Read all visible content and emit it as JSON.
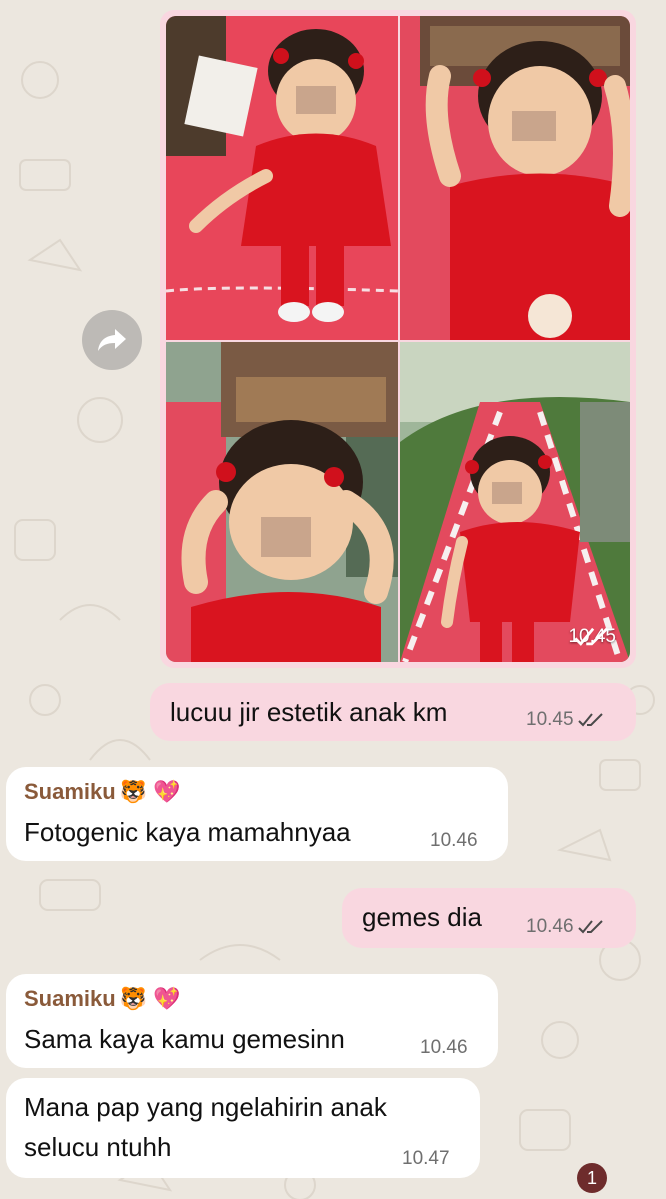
{
  "colors": {
    "chat_background": "#ece7df",
    "outgoing_bubble": "#f9d7e0",
    "incoming_bubble": "#ffffff",
    "sender_name": "#8a5a3a",
    "unread_badge": "#6e2c2c"
  },
  "photo_message": {
    "photo_count": 4,
    "time": "10.45",
    "status_icon": "double-check-icon"
  },
  "messages": [
    {
      "direction": "outgoing",
      "text": "lucuu jir estetik anak km",
      "time": "10.45",
      "status_icon": "double-check-icon"
    },
    {
      "direction": "incoming",
      "sender": "Suamiku",
      "sender_emoji": "🐯 💖",
      "text": "Fotogenic kaya mamahnyaa",
      "time": "10.46"
    },
    {
      "direction": "outgoing",
      "text": "gemes dia",
      "time": "10.46",
      "status_icon": "double-check-icon"
    },
    {
      "direction": "incoming",
      "sender": "Suamiku",
      "sender_emoji": "🐯 💖",
      "text": "Sama kaya kamu gemesinn",
      "time": "10.46"
    },
    {
      "direction": "incoming",
      "text_line1": "Mana pap yang ngelahirin anak",
      "text_line2": "selucu ntuhh",
      "time": "10.47"
    }
  ],
  "forward_icon": "forward-arrow-icon",
  "unread_badge": "1"
}
